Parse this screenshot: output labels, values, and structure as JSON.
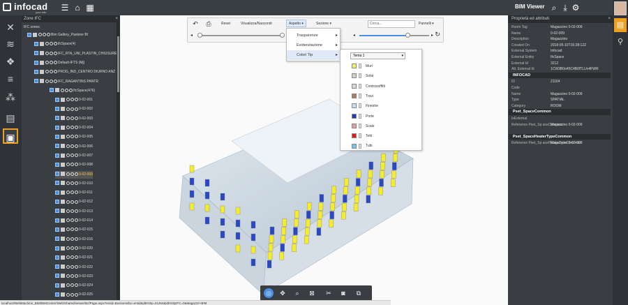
{
  "app": {
    "logo_text": "infocad",
    "logo_sub": "your info manager",
    "viewer_title": "BIM Viewer"
  },
  "left_panel": {
    "title": "Zone IFC",
    "root": "IFC zones",
    "items": [
      "Bim Gallery_Paolone BI",
      "ifcSpace(4)",
      "IFC_RTA_UNI_PLASTIN_CHIUSURE",
      "Default-IFTS (Mj)",
      "PROG_IND_CENTRO DIURNO ANZ",
      "IFC_RAGANTINS PANTR",
      "IfcSpace(476)",
      "0-02-001",
      "0-02-002",
      "0-02-003",
      "0-02-004",
      "0-02-005",
      "0-02-006",
      "0-02-007",
      "0-02-008",
      "0-02-009",
      "0-02-010",
      "0-02-011",
      "0-02-012",
      "0-02-013",
      "0-02-014",
      "0-02-015",
      "0-02-016",
      "0-02-020",
      "0-02-021",
      "0-02-022",
      "0-02-023",
      "0-02-024",
      "0-02-025"
    ],
    "selected_item": "0-02-009"
  },
  "toolbar": {
    "reset": "Reset",
    "view_hide": "Visualizza/Nascondi",
    "appearance": "Aspetto",
    "sections": "Sezione",
    "search_placeholder": "Cerca...",
    "panels": "Pannelli"
  },
  "appearance_menu": {
    "items": [
      "Trasparenze",
      "Evidenziazione",
      "Colori  Tip"
    ],
    "hovered": "Colori  Tip"
  },
  "colors_menu": {
    "selected_theme": "Tema 1",
    "entries": [
      {
        "label": "Muri",
        "color": "#f2f061"
      },
      {
        "label": "Solai",
        "color": "#cfcfcf"
      },
      {
        "label": "Controsoffitti",
        "color": "#d8d8d8"
      },
      {
        "label": "Travi",
        "color": "#b07c58"
      },
      {
        "label": "Finestre",
        "color": "#bfe0f2"
      },
      {
        "label": "Porte",
        "color": "#1f3fb8"
      },
      {
        "label": "Scale",
        "color": "#e89aa6"
      },
      {
        "label": "Tetti",
        "color": "#e01a1a"
      },
      {
        "label": "Tubi",
        "color": "#73c3ea"
      }
    ]
  },
  "right_panel": {
    "title": "Proprietà ed attributi",
    "rows_top": [
      [
        "Room Tag",
        "Magazzino 0-02-009"
      ],
      [
        "Name",
        "0-02-009"
      ],
      [
        "Description",
        "Magazzino"
      ],
      [
        "Created On",
        "2018-05-10T16:28:12Z"
      ],
      [
        "External System",
        "Infocad"
      ],
      [
        "External Entity",
        "IfcSpace"
      ],
      [
        "External Id",
        "3212"
      ],
      [
        "Alt. External Id",
        "1CW3B0o45C4B0fTLUn4FWR"
      ]
    ],
    "section_infocad": "INFOCAD",
    "rows_infocad": [
      [
        "ID",
        "21164"
      ],
      [
        "Code",
        ""
      ],
      [
        "Name",
        "Magazzino 0-02-009"
      ],
      [
        "Type",
        "SPATIAL"
      ],
      [
        "Category",
        "ROOM"
      ]
    ],
    "section_common": "Pset_SpaceCommon",
    "rows_common": [
      [
        "IsExternal",
        ""
      ],
      [
        "Reference Pset_Sp aceCommon",
        "Magazzino 0-02-009"
      ]
    ],
    "section_heater": "Pset_SpaceHeaterTypeCommon",
    "rows_heater": [
      [
        "Reference Pset_Sp aceHeaterTypeCom mon",
        "Magazzino 0-02-009"
      ]
    ]
  },
  "status_url": "localhost/WebMachine_BIM/BIMCenter/Web/Shared/viewer/BcfPage.aspx?entid=Business/bc=entid&idEntity=21254&idEntityIFC=0&Magazz#+BIM",
  "accent_color": "#f0a020"
}
